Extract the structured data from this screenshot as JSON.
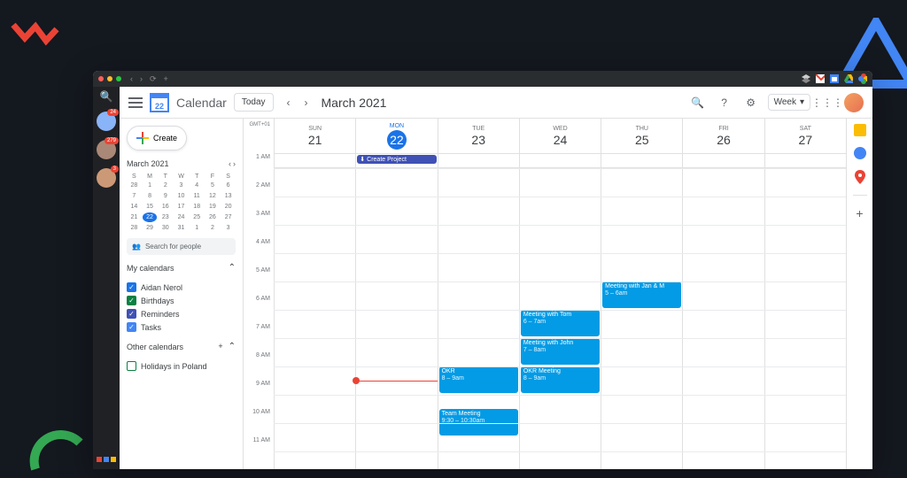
{
  "titlebar": {
    "stack_icon": "stack",
    "gmail": "gmail",
    "drive": "drive",
    "photos": "photos"
  },
  "sidebar_strip": {
    "badges": [
      "24",
      "279",
      "3"
    ]
  },
  "topbar": {
    "app_name": "Calendar",
    "logo_day": "22",
    "today_label": "Today",
    "month_title": "March 2021",
    "view_label": "Week"
  },
  "leftpanel": {
    "create_label": "Create",
    "mini_month": "March 2021",
    "weekdays": [
      "S",
      "M",
      "T",
      "W",
      "T",
      "F",
      "S"
    ],
    "days": [
      [
        28,
        1,
        2,
        3,
        4,
        5,
        6
      ],
      [
        7,
        8,
        9,
        10,
        11,
        12,
        13
      ],
      [
        14,
        15,
        16,
        17,
        18,
        19,
        20
      ],
      [
        21,
        22,
        23,
        24,
        25,
        26,
        27
      ],
      [
        28,
        29,
        30,
        31,
        1,
        2,
        3
      ]
    ],
    "today": 22,
    "search_placeholder": "Search for people",
    "my_calendars_label": "My calendars",
    "my_calendars": [
      {
        "label": "Aidan Nerol",
        "color": "blue",
        "checked": true
      },
      {
        "label": "Birthdays",
        "color": "green",
        "checked": true
      },
      {
        "label": "Reminders",
        "color": "purple",
        "checked": true
      },
      {
        "label": "Tasks",
        "color": "teal",
        "checked": true
      }
    ],
    "other_calendars_label": "Other calendars",
    "other_calendars": [
      {
        "label": "Holidays in Poland",
        "color": "empty",
        "checked": false
      }
    ]
  },
  "grid": {
    "timezone": "GMT+01",
    "hours": [
      "1 AM",
      "2 AM",
      "3 AM",
      "4 AM",
      "5 AM",
      "6 AM",
      "7 AM",
      "8 AM",
      "9 AM",
      "10 AM",
      "11 AM"
    ],
    "days": [
      {
        "dow": "SUN",
        "num": "21",
        "today": false
      },
      {
        "dow": "MON",
        "num": "22",
        "today": true
      },
      {
        "dow": "TUE",
        "num": "23",
        "today": false
      },
      {
        "dow": "WED",
        "num": "24",
        "today": false
      },
      {
        "dow": "THU",
        "num": "25",
        "today": false
      },
      {
        "dow": "FRI",
        "num": "26",
        "today": false
      },
      {
        "dow": "SAT",
        "num": "27",
        "today": false
      }
    ],
    "allday": {
      "day": 1,
      "title": "Create Project"
    },
    "now_hour": 8.5,
    "events": [
      {
        "day": 4,
        "start": 5,
        "end": 6,
        "title": "Meeting with Jan & M",
        "time": "5 – 6am"
      },
      {
        "day": 3,
        "start": 6,
        "end": 7,
        "title": "Meeting with Tom",
        "time": "6 – 7am"
      },
      {
        "day": 3,
        "start": 7,
        "end": 8,
        "title": "Meeting with John",
        "time": "7 – 8am"
      },
      {
        "day": 2,
        "start": 8,
        "end": 9,
        "title": "OKR",
        "time": "8 – 9am"
      },
      {
        "day": 3,
        "start": 8,
        "end": 9,
        "title": "OKR Meeting",
        "time": "8 – 9am"
      },
      {
        "day": 2,
        "start": 9.5,
        "end": 10.5,
        "title": "Team Meeting",
        "time": "9:30 – 10:30am"
      }
    ]
  }
}
